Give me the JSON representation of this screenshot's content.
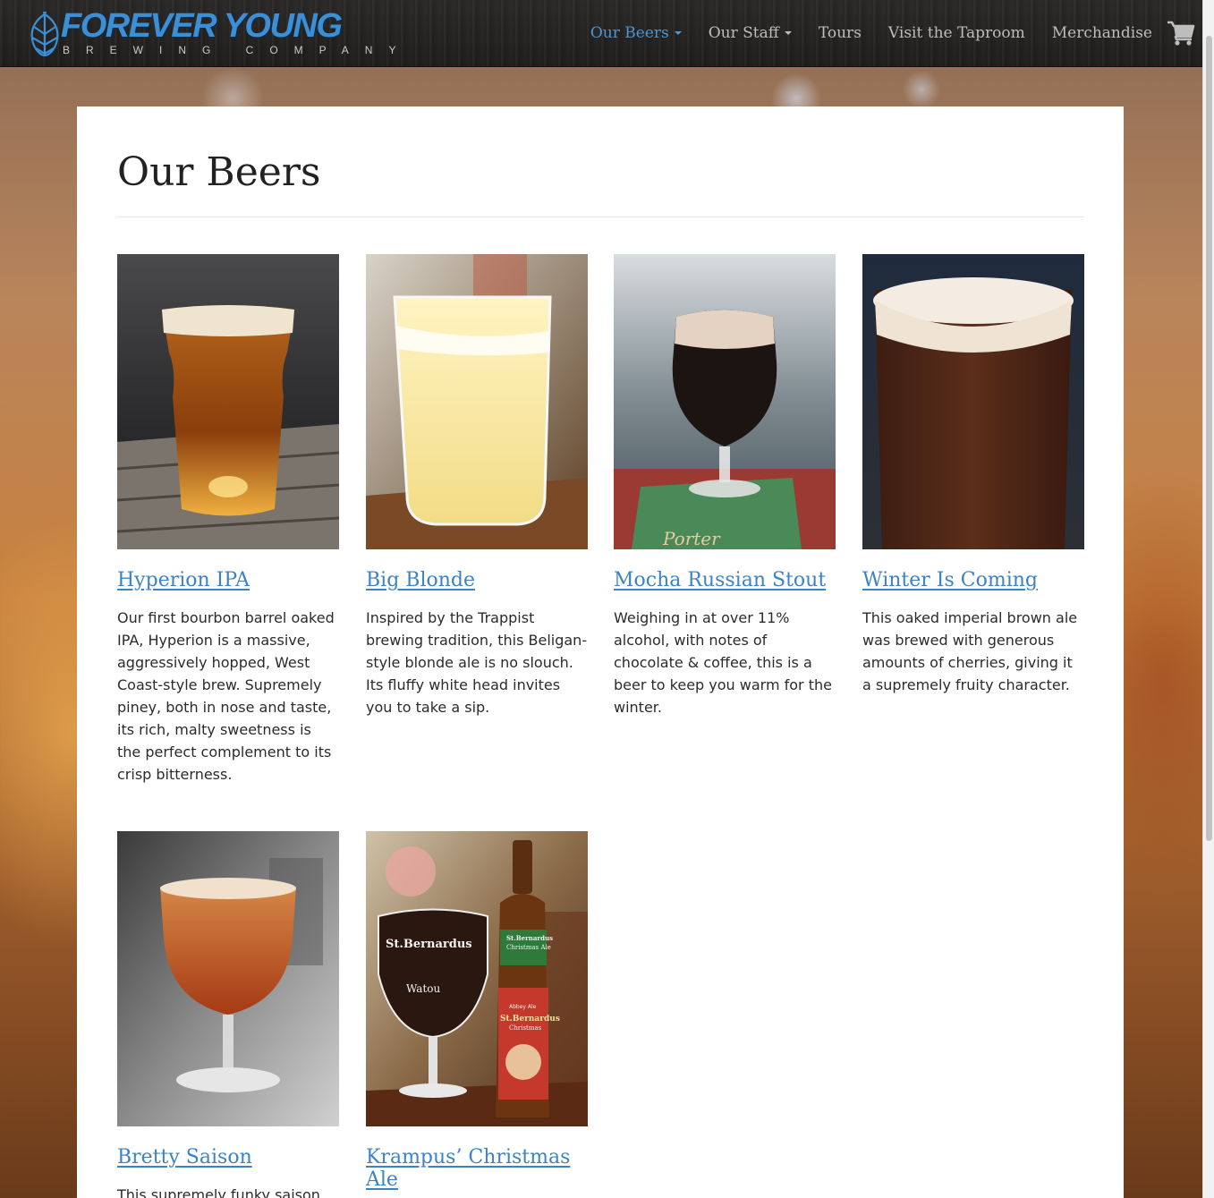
{
  "brand": {
    "title": "FOREVER YOUNG",
    "subtitle": "BREWING COMPANY"
  },
  "nav": {
    "items": [
      {
        "label": "Our Beers",
        "dropdown": true,
        "active": true
      },
      {
        "label": "Our Staff",
        "dropdown": true,
        "active": false
      },
      {
        "label": "Tours",
        "dropdown": false,
        "active": false
      },
      {
        "label": "Visit the Taproom",
        "dropdown": false,
        "active": false
      },
      {
        "label": "Merchandise",
        "dropdown": false,
        "active": false
      }
    ],
    "cart_icon": "shopping-cart-icon"
  },
  "page": {
    "title": "Our Beers"
  },
  "beers": [
    {
      "name": "Hyperion IPA",
      "description": "Our first bourbon barrel oaked IPA, Hyperion is a massive, aggressively hopped, West Coast-style brew. Supremely piney, both in nose and taste, its rich, malty sweetness is the perfect complement to its crisp bitterness."
    },
    {
      "name": "Big Blonde",
      "description": "Inspired by the Trappist brewing tradition, this Beligan-style blonde ale is no slouch. Its fluffy white head invites you to take a sip."
    },
    {
      "name": "Mocha Russian Stout",
      "description": "Weighing in at over 11% alcohol, with notes of chocolate & coffee, this is a beer to keep you warm for the winter."
    },
    {
      "name": "Winter Is Coming",
      "description": "This oaked imperial brown ale was brewed with generous amounts of cherries, giving it a supremely fruity character."
    },
    {
      "name": "Bretty Saison",
      "description": "This supremely funky saison"
    },
    {
      "name": "Krampus’ Christmas Ale",
      "description": ""
    }
  ],
  "photo_text": {
    "porter_coaster": "Porter",
    "glass_brand": "St.Bernardus",
    "glass_town": "Watou",
    "bottle_brand": "St.Bernardus",
    "bottle_name": "Christmas Ale",
    "bottle_style": "Abbey Ale",
    "bottle_label_name": "St.Bernardus",
    "bottle_label_sub": "Christmas"
  },
  "colors": {
    "accent": "#3b83c4",
    "nav_active": "#4a97d6",
    "nav_text": "#bdbdbd",
    "navbar_bg": "#222120",
    "panel_bg": "#ffffff"
  }
}
